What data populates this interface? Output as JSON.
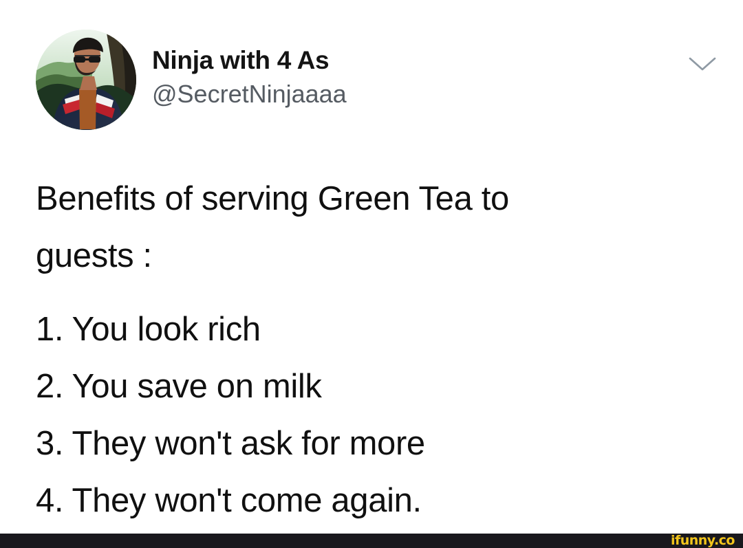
{
  "tweet": {
    "author": {
      "display_name": "Ninja with 4 As",
      "handle": "@SecretNinjaaaa",
      "avatar_icon": "avatar-icon"
    },
    "menu_icon": "chevron-down-icon",
    "text": {
      "intro_line_1": "Benefits of serving Green Tea to",
      "intro_line_2": "guests :",
      "benefits": [
        "1. You look rich",
        "2. You save on milk",
        "3. They won't ask for more",
        "4. They won't come again."
      ]
    }
  },
  "watermark": {
    "text": "ifunny.co",
    "background": "#19181d",
    "color": "#f3c51c"
  },
  "colors": {
    "background": "#ffffff",
    "primary_text": "#111111",
    "secondary_text": "#555b62",
    "icon_gray": "#8f9aa4"
  }
}
